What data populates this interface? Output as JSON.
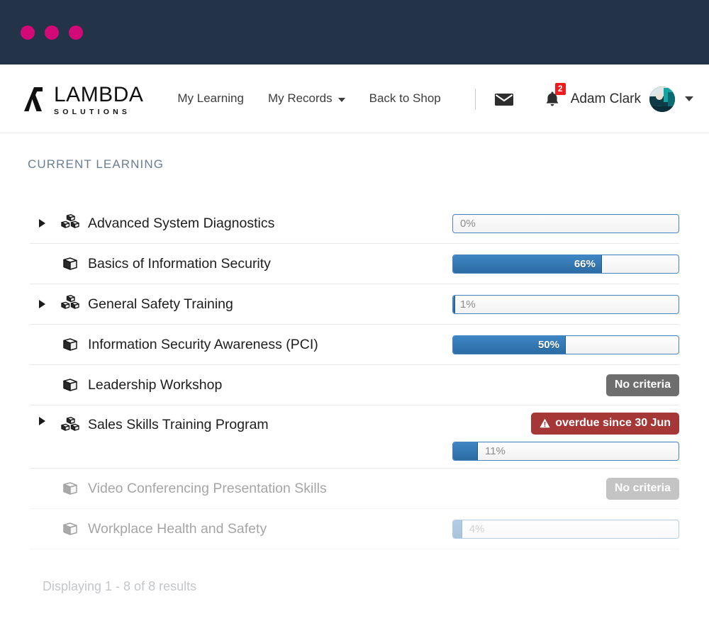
{
  "window": {
    "dots": [
      "dot-1",
      "dot-2",
      "dot-3"
    ],
    "dot_color": "#d10a78",
    "bar_color": "#233348"
  },
  "header": {
    "logo": {
      "name": "LAMBDA",
      "tagline": "SOLUTIONS"
    },
    "nav": [
      {
        "label": "My Learning",
        "has_caret": false
      },
      {
        "label": "My Records",
        "has_caret": true
      },
      {
        "label": "Back to Shop",
        "has_caret": false
      }
    ],
    "mail_icon": "envelope-icon",
    "bell_icon": "bell-icon",
    "notification_count": "2",
    "notification_color": "#ee1c1c",
    "user_name": "Adam Clark",
    "avatar_icon": "user-avatar"
  },
  "main": {
    "section_title": "CURRENT LEARNING",
    "footer_note": "Displaying 1 - 8 of 8 results",
    "rows": [
      {
        "title": "Advanced System Diagnostics",
        "type": "program",
        "icon": "cubes-icon",
        "expandable": true,
        "status": {
          "kind": "progress",
          "percent": 0,
          "label": "0%",
          "label_position": "outside"
        },
        "faded": false
      },
      {
        "title": "Basics of Information Security",
        "type": "course",
        "icon": "cube-icon",
        "expandable": false,
        "status": {
          "kind": "progress",
          "percent": 66,
          "label": "66%",
          "label_position": "inside"
        },
        "faded": false
      },
      {
        "title": "General Safety Training",
        "type": "program",
        "icon": "cubes-icon",
        "expandable": true,
        "status": {
          "kind": "progress",
          "percent": 1,
          "label": "1%",
          "label_position": "outside"
        },
        "faded": false
      },
      {
        "title": "Information Security Awareness (PCI)",
        "type": "course",
        "icon": "cube-icon",
        "expandable": false,
        "status": {
          "kind": "progress",
          "percent": 50,
          "label": "50%",
          "label_position": "inside"
        },
        "faded": false
      },
      {
        "title": "Leadership Workshop",
        "type": "course",
        "icon": "cube-icon",
        "expandable": false,
        "status": {
          "kind": "badge",
          "variant": "gray",
          "label": "No criteria"
        },
        "faded": false
      },
      {
        "title": "Sales Skills Training Program",
        "type": "program",
        "icon": "cubes-icon",
        "expandable": true,
        "status": {
          "kind": "badge-and-progress",
          "variant": "red",
          "label": "overdue since 30 Jun",
          "warning_icon": "warning-triangle-icon",
          "percent": 11,
          "progress_label": "11%",
          "label_position": "outside"
        },
        "faded": false
      },
      {
        "title": "Video Conferencing Presentation Skills",
        "type": "course",
        "icon": "cube-icon",
        "expandable": false,
        "status": {
          "kind": "badge",
          "variant": "gray",
          "label": "No criteria"
        },
        "faded": true
      },
      {
        "title": "Workplace Health and Safety",
        "type": "course",
        "icon": "cube-icon",
        "expandable": false,
        "status": {
          "kind": "progress",
          "percent": 4,
          "label": "4%",
          "label_position": "outside"
        },
        "faded": true
      }
    ]
  },
  "colors": {
    "accent_pink": "#d10a78",
    "navy": "#233348",
    "progress_blue": "#2b6ca3",
    "progress_border": "#4b87bf",
    "badge_gray": "#6e6e6e",
    "badge_red": "#a63737",
    "section_title": "#6b7d91"
  }
}
